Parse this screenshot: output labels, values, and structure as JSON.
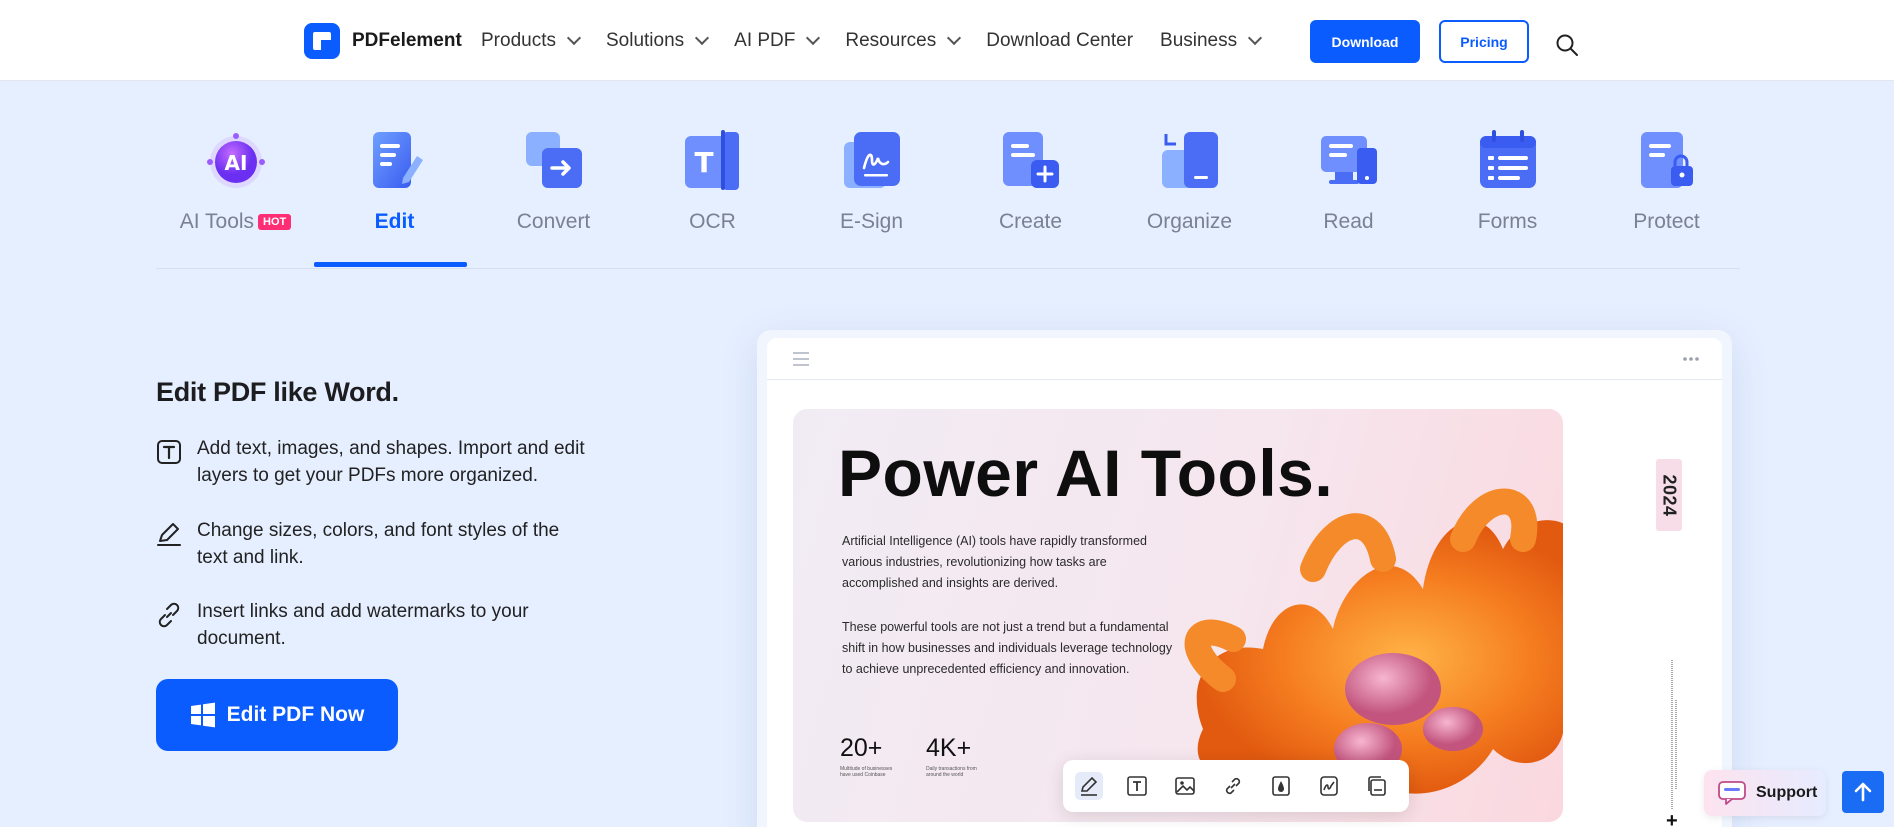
{
  "header": {
    "brand": "PDFelement",
    "nav": [
      {
        "label": "Products",
        "dropdown": true
      },
      {
        "label": "Solutions",
        "dropdown": true
      },
      {
        "label": "AI PDF",
        "dropdown": true
      },
      {
        "label": "Resources",
        "dropdown": true
      },
      {
        "label": "Download Center",
        "dropdown": false
      },
      {
        "label": "Business",
        "dropdown": true
      }
    ],
    "download_label": "Download",
    "pricing_label": "Pricing"
  },
  "tabs": [
    {
      "label": "AI Tools",
      "badge": "HOT",
      "icon": "ai-tools-icon"
    },
    {
      "label": "Edit",
      "icon": "edit-icon",
      "active": true
    },
    {
      "label": "Convert",
      "icon": "convert-icon"
    },
    {
      "label": "OCR",
      "icon": "ocr-icon"
    },
    {
      "label": "E-Sign",
      "icon": "esign-icon"
    },
    {
      "label": "Create",
      "icon": "create-icon"
    },
    {
      "label": "Organize",
      "icon": "organize-icon"
    },
    {
      "label": "Read",
      "icon": "read-icon"
    },
    {
      "label": "Forms",
      "icon": "forms-icon"
    },
    {
      "label": "Protect",
      "icon": "protect-icon"
    }
  ],
  "feature": {
    "title": "Edit PDF like Word.",
    "bullets": [
      {
        "icon": "text-box-icon",
        "text": "Add text, images, and shapes. Import and edit layers to get your PDFs more organized."
      },
      {
        "icon": "pen-edit-icon",
        "text": "Change sizes, colors, and font styles of the text and link."
      },
      {
        "icon": "link-icon",
        "text": "Insert links and add watermarks to your document."
      }
    ],
    "cta_label": "Edit PDF Now"
  },
  "preview": {
    "poster_title": "Power AI Tools.",
    "paragraph_1": "Artificial Intelligence (AI) tools have rapidly transformed various industries, revolutionizing how tasks are accomplished and insights are derived.",
    "paragraph_2": "These powerful tools are not just a trend but a fundamental shift in how businesses and individuals leverage technology to achieve unprecedented efficiency and innovation.",
    "stats": [
      {
        "value": "20+",
        "caption": "Multitude of businesses have used Coinbase"
      },
      {
        "value": "4K+",
        "caption": "Daily transactions from around the world"
      }
    ],
    "year": "2024",
    "plus_marks": [
      "+",
      "+"
    ],
    "toolbar": [
      "pen-icon",
      "text-icon",
      "image-icon",
      "link-icon",
      "watermark-icon",
      "signature-icon",
      "page-icon"
    ]
  },
  "support_label": "Support",
  "colors": {
    "accent": "#0b5cff",
    "background": "#e6efff",
    "hot": "#ff2e74"
  }
}
